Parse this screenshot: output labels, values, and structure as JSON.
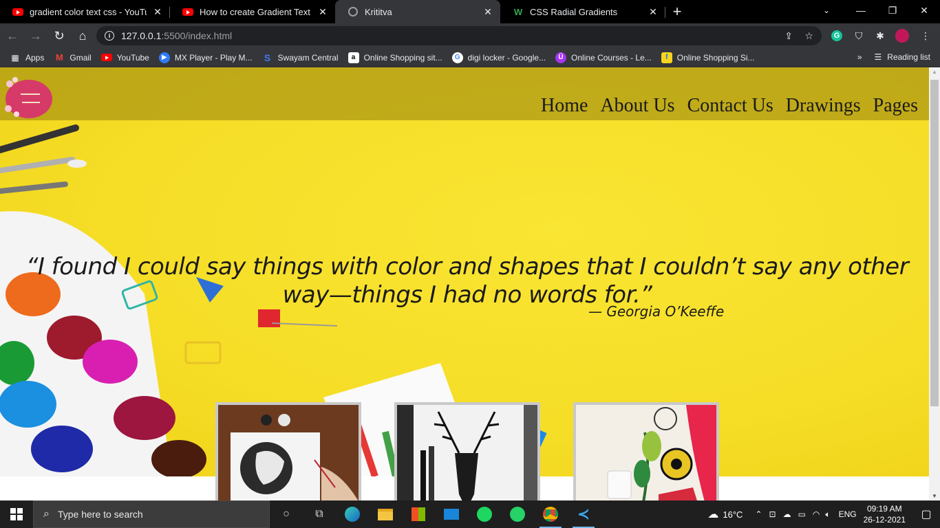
{
  "tabs": [
    {
      "title": "gradient color text css - YouTube",
      "icon": "youtube-icon"
    },
    {
      "title": "How to create Gradient Text usin",
      "icon": "youtube-icon"
    },
    {
      "title": "Krititva",
      "icon": "globe-icon",
      "active": true
    },
    {
      "title": "CSS Radial Gradients",
      "icon": "w3schools-icon"
    }
  ],
  "address": {
    "host": "127.0.0.1",
    "path": ":5500/index.html"
  },
  "bookmarks": [
    {
      "label": "Apps",
      "icon": "apps-grid-icon"
    },
    {
      "label": "Gmail",
      "icon": "gmail-icon"
    },
    {
      "label": "YouTube",
      "icon": "youtube-icon"
    },
    {
      "label": "MX Player - Play M...",
      "icon": "mx-player-icon"
    },
    {
      "label": "Swayam Central",
      "icon": "swayam-icon"
    },
    {
      "label": "Online Shopping sit...",
      "icon": "amazon-icon"
    },
    {
      "label": "digi locker - Google...",
      "icon": "google-icon"
    },
    {
      "label": "Online Courses - Le...",
      "icon": "udemy-icon"
    },
    {
      "label": "Online Shopping Si...",
      "icon": "flipkart-icon"
    }
  ],
  "reading_list": "Reading list",
  "page": {
    "nav": [
      "Home",
      "About Us",
      "Contact Us",
      "Drawings",
      "Pages"
    ],
    "quote": "“I found I could say things with color and shapes that I couldn’t say any other way—things I had no words for.”",
    "author": "— Georgia O’Keeffe",
    "accent": "#f6de27",
    "header_bg": "#b7a81c"
  },
  "taskbar": {
    "search_placeholder": "Type here to search",
    "weather": "16°C",
    "language": "ENG",
    "time": "09:19 AM",
    "date": "26-12-2021"
  }
}
